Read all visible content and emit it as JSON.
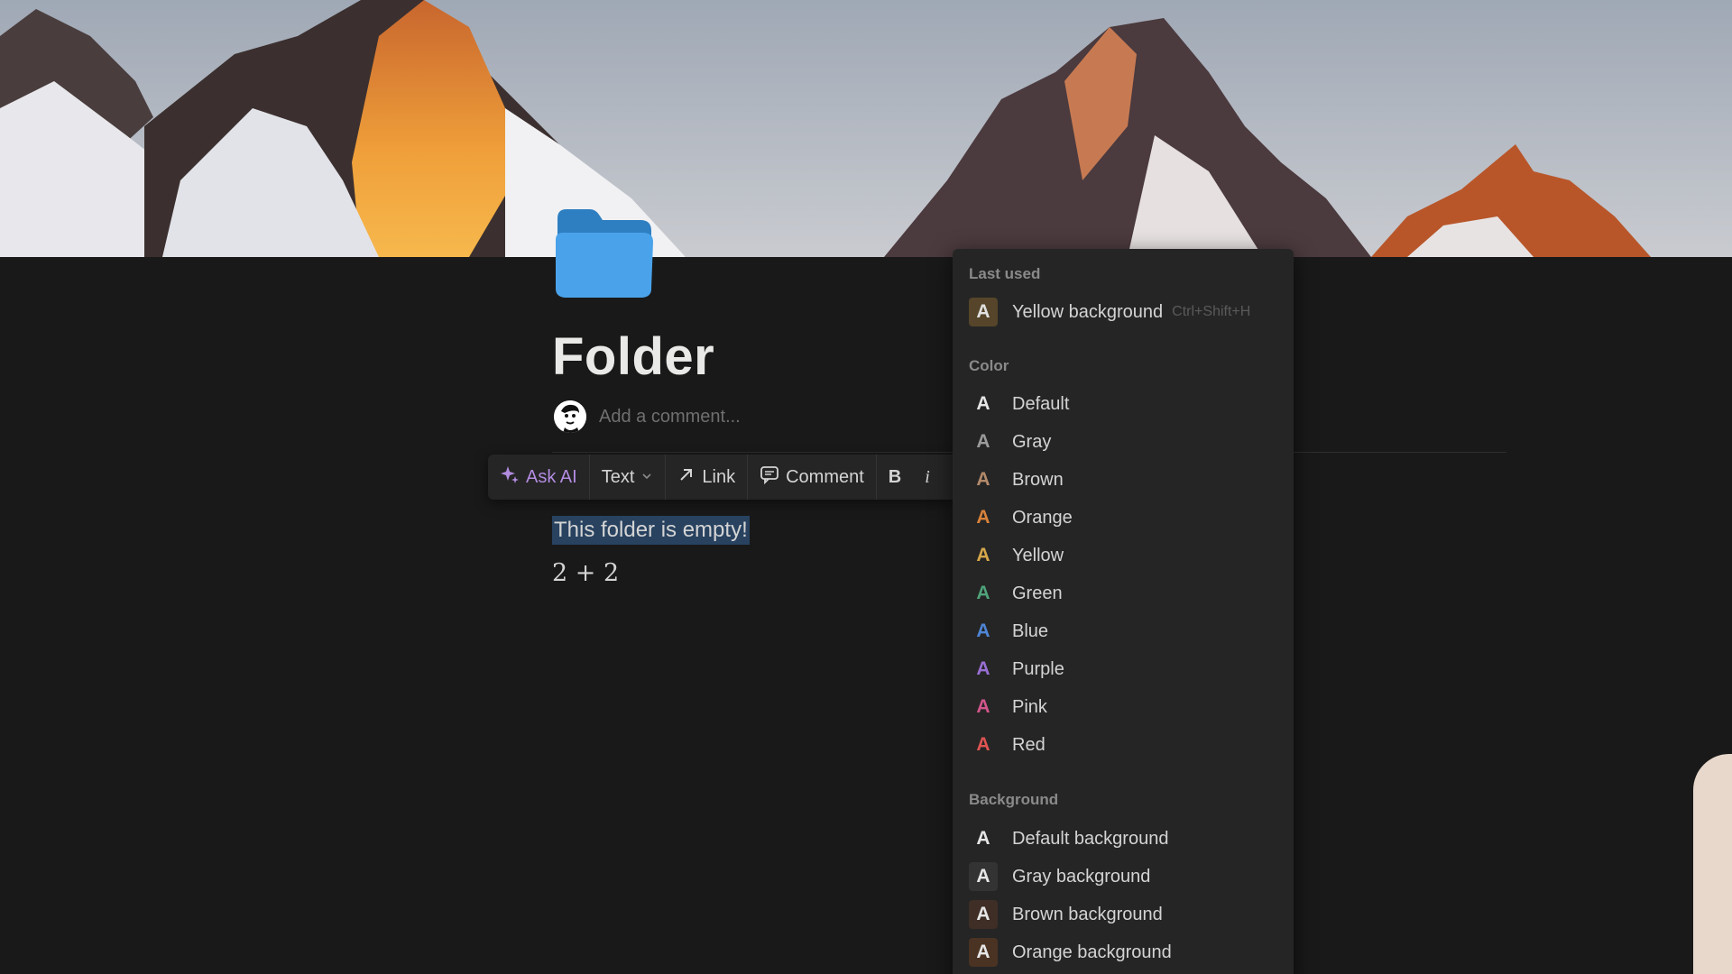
{
  "page": {
    "title": "Folder",
    "comment_placeholder": "Add a comment...",
    "icon": "folder-icon",
    "selected_text": "This folder is empty!",
    "math_text": "2 + 2"
  },
  "toolbar": {
    "ask_ai": "Ask AI",
    "text": "Text",
    "link": "Link",
    "comment": "Comment",
    "bold": "B",
    "italic": "i"
  },
  "menu": {
    "last_used_label": "Last used",
    "last_used": {
      "label": "Yellow background",
      "shortcut": "Ctrl+Shift+H",
      "bg": "#56452a",
      "fg": "#e0e0e0"
    },
    "color_label": "Color",
    "colors": [
      {
        "label": "Default",
        "color": "#e6e6e6"
      },
      {
        "label": "Gray",
        "color": "#9b9b9b"
      },
      {
        "label": "Brown",
        "color": "#b38a6a"
      },
      {
        "label": "Orange",
        "color": "#d9823b"
      },
      {
        "label": "Yellow",
        "color": "#d6a84a"
      },
      {
        "label": "Green",
        "color": "#4fa37a"
      },
      {
        "label": "Blue",
        "color": "#4f86d6"
      },
      {
        "label": "Purple",
        "color": "#9a6fd4"
      },
      {
        "label": "Pink",
        "color": "#d1568c"
      },
      {
        "label": "Red",
        "color": "#df5452"
      }
    ],
    "background_label": "Background",
    "backgrounds": [
      {
        "label": "Default background",
        "bg": "transparent",
        "fg": "#e6e6e6"
      },
      {
        "label": "Gray background",
        "bg": "#333333",
        "fg": "#e6e6e6"
      },
      {
        "label": "Brown background",
        "bg": "#3f2e26",
        "fg": "#e6e6e6"
      },
      {
        "label": "Orange background",
        "bg": "#4a3322",
        "fg": "#e6e6e6"
      }
    ]
  },
  "swatch_letter": "A",
  "colors": {
    "background": "#191919",
    "menu": "#252525",
    "selection": "#284260",
    "ai_accent": "#b28ce0"
  }
}
